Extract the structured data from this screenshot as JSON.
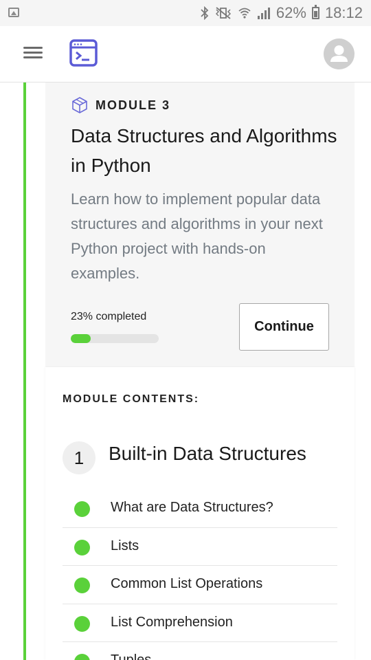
{
  "status_bar": {
    "battery_percent": "62%",
    "time": "18:12"
  },
  "app_bar": {
    "logo_icon": "terminal-window-icon",
    "avatar_icon": "user-icon",
    "colors": {
      "logo": "#5b5bd6",
      "accent": "#5ad13a"
    }
  },
  "module": {
    "tag": "MODULE 3",
    "tag_icon": "cube-icon",
    "title": "Data Structures and Algorithms in Python",
    "description": "Learn how to implement popular data structures and algorithms in your next Python project with hands-on examples.",
    "progress_label": "23% completed",
    "progress_fraction": 0.23,
    "continue_label": "Continue"
  },
  "contents": {
    "heading": "MODULE CONTENTS:",
    "section": {
      "number": "1",
      "title": "Built-in Data Structures"
    },
    "lessons": [
      {
        "label": "What are Data Structures?",
        "completed": true
      },
      {
        "label": "Lists",
        "completed": true
      },
      {
        "label": "Common List Operations",
        "completed": true
      },
      {
        "label": "List Comprehension",
        "completed": true
      },
      {
        "label": "Tuples",
        "completed": true
      }
    ]
  }
}
